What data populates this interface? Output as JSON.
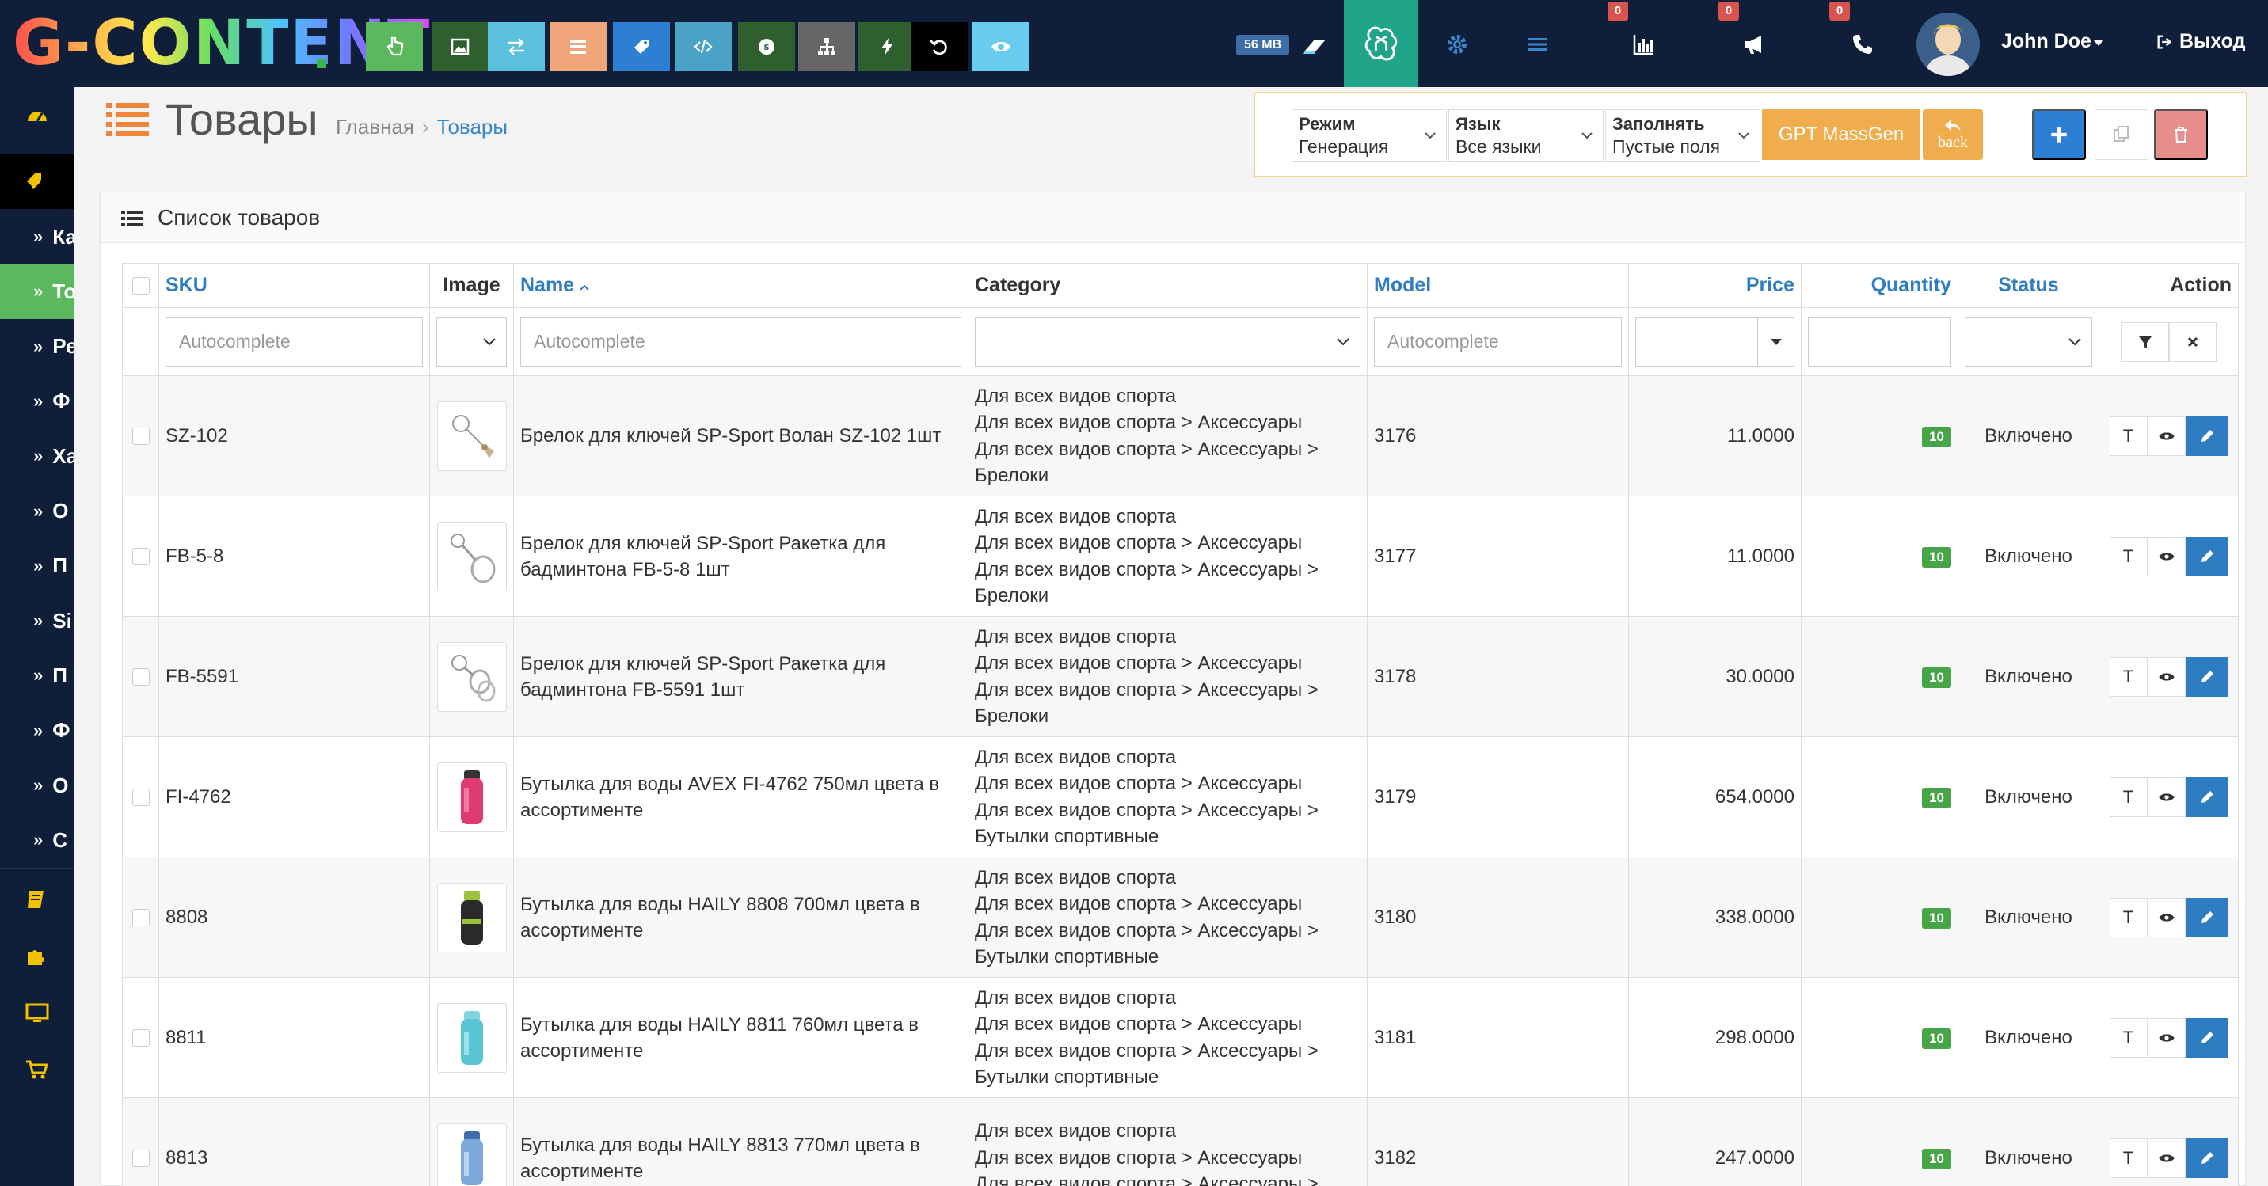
{
  "app": {
    "logo_text": "G-CONTENT",
    "memory_badge": "56 MB",
    "user_name": "John Doe",
    "logout_label": "Выход",
    "notifications": {
      "stats": "0",
      "marketing": "0",
      "calls": "0"
    }
  },
  "toolbar_buttons": [
    {
      "name": "hand-pointer-tool-button",
      "icon": "hand-pointer-icon",
      "color": "#5cb85c"
    },
    {
      "name": "image-tool-button",
      "icon": "image-icon",
      "color": "#2f5e2f"
    },
    {
      "name": "exchange-tool-button",
      "icon": "exchange-icon",
      "color": "#5bc0de"
    },
    {
      "name": "list-tool-button",
      "icon": "list-icon",
      "color": "#f0a47a"
    },
    {
      "name": "tag-tool-button",
      "icon": "tag-icon",
      "color": "#2d7fd3"
    },
    {
      "name": "code-tool-button",
      "icon": "code-icon",
      "color": "#4aa3c7"
    },
    {
      "name": "seo-tool-button",
      "icon": "seo-icon",
      "color": "#2f5e2f"
    },
    {
      "name": "sitemap-tool-button",
      "icon": "sitemap-icon",
      "color": "#666666"
    },
    {
      "name": "bolt-tool-button",
      "icon": "bolt-icon",
      "color": "#2f5e2f"
    },
    {
      "name": "undo-tool-button",
      "icon": "undo-icon",
      "color": "#000000"
    },
    {
      "name": "eye-tool-button",
      "icon": "eye-icon",
      "color": "#67ccef"
    }
  ],
  "page": {
    "title": "Товары",
    "breadcrumb_home": "Главная",
    "breadcrumb_current": "Товары",
    "panel_title": "Список товаров"
  },
  "tool_panel": {
    "mode_label": "Режим",
    "mode_value": "Генерация",
    "language_label": "Язык",
    "language_value": "Все языки",
    "fill_label": "Заполнять",
    "fill_value": "Пустые поля",
    "massgen_label": "GPT MassGen",
    "back_label": "back"
  },
  "sidebar": {
    "sub_items": [
      "Ка",
      "То",
      "Ре",
      "Ф",
      "Ха",
      "О",
      "П",
      "Si",
      "П",
      "Ф",
      "О",
      "С"
    ],
    "active_sub_index": 1
  },
  "table": {
    "headers": {
      "sku": "SKU",
      "image": "Image",
      "name": "Name",
      "category": "Category",
      "model": "Model",
      "price": "Price",
      "quantity": "Quantity",
      "status": "Status",
      "action": "Action"
    },
    "filters": {
      "sku_placeholder": "Autocomplete",
      "name_placeholder": "Autocomplete",
      "model_placeholder": "Autocomplete"
    },
    "row_action_t": "T",
    "rows": [
      {
        "sku": "SZ-102",
        "name": "Брелок для ключей SP-Sport Волан SZ-102 1шт",
        "category": [
          "Для всех видов спорта",
          "Для всех видов спорта > Аксессуары",
          "Для всех видов спорта  >  Аксессуары >",
          "Брелоки"
        ],
        "model": "3176",
        "price": "11.0000",
        "quantity": "10",
        "status": "Включено",
        "thumb": "keychain-shuttlecock"
      },
      {
        "sku": "FB-5-8",
        "name": "Брелок для ключей SP-Sport Ракетка для бадминтона FB-5-8 1шт",
        "category": [
          "Для всех видов спорта",
          "Для всех видов спорта > Аксессуары",
          "Для всех видов спорта  >  Аксессуары >",
          "Брелоки"
        ],
        "model": "3177",
        "price": "11.0000",
        "quantity": "10",
        "status": "Включено",
        "thumb": "keychain-racket"
      },
      {
        "sku": "FB-5591",
        "name": "Брелок для ключей SP-Sport Ракетка для бадминтона FB-5591 1шт",
        "category": [
          "Для всех видов спорта",
          "Для всех видов спорта > Аксессуары",
          "Для всех видов спорта  >  Аксессуары >",
          "Брелоки"
        ],
        "model": "3178",
        "price": "30.0000",
        "quantity": "10",
        "status": "Включено",
        "thumb": "keychain-rackets"
      },
      {
        "sku": "FI-4762",
        "name": "Бутылка для воды AVEX FI-4762 750мл цвета в ассортименте",
        "category": [
          "Для всех видов спорта",
          "Для всех видов спорта > Аксессуары",
          "Для всех видов спорта  >  Аксессуары >",
          "Бутылки спортивные"
        ],
        "model": "3179",
        "price": "654.0000",
        "quantity": "10",
        "status": "Включено",
        "thumb": "bottle-pink"
      },
      {
        "sku": "8808",
        "name": "Бутылка для воды HAILY 8808 700мл цвета в ассортименте",
        "category": [
          "Для всех видов спорта",
          "Для всех видов спорта > Аксессуары",
          "Для всех видов спорта  >  Аксессуары >",
          "Бутылки спортивные"
        ],
        "model": "3180",
        "price": "338.0000",
        "quantity": "10",
        "status": "Включено",
        "thumb": "bottle-black"
      },
      {
        "sku": "8811",
        "name": "Бутылка для воды HAILY 8811 760мл цвета в ассортименте",
        "category": [
          "Для всех видов спорта",
          "Для всех видов спорта > Аксессуары",
          "Для всех видов спорта  >  Аксессуары >",
          "Бутылки спортивные"
        ],
        "model": "3181",
        "price": "298.0000",
        "quantity": "10",
        "status": "Включено",
        "thumb": "bottle-teal"
      },
      {
        "sku": "8813",
        "name": "Бутылка для воды HAILY 8813 770мл цвета в ассортименте",
        "category": [
          "Для всех видов спорта",
          "Для всех видов спорта > Аксессуары",
          "Для всех видов спорта  >  Аксессуары >"
        ],
        "model": "3182",
        "price": "247.0000",
        "quantity": "10",
        "status": "Включено",
        "thumb": "bottle-blue"
      }
    ]
  }
}
